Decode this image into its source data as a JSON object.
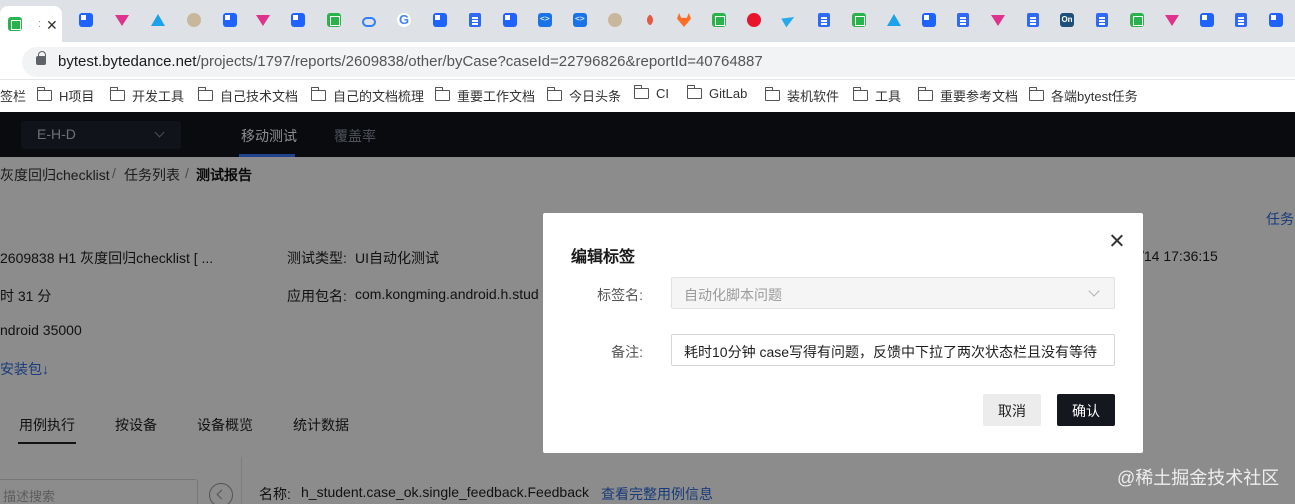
{
  "browser": {
    "active_tab_label": ":",
    "url_host": "bytest.bytedance.net",
    "url_path": "/projects/1797/reports/2609838/other/byCase?caseId=22796826&reportId=40764887"
  },
  "bookmarks": [
    {
      "label": "签栏",
      "folder": false
    },
    {
      "label": "H项目",
      "folder": true
    },
    {
      "label": "开发工具",
      "folder": true
    },
    {
      "label": "自己技术文档",
      "folder": true
    },
    {
      "label": "自己的文档梳理",
      "folder": true
    },
    {
      "label": "重要工作文档",
      "folder": true
    },
    {
      "label": "今日头条",
      "folder": true
    },
    {
      "label": "CI",
      "folder": true
    },
    {
      "label": "GitLab",
      "folder": true
    },
    {
      "label": "装机软件",
      "folder": true
    },
    {
      "label": "工具",
      "folder": true
    },
    {
      "label": "重要参考文档",
      "folder": true
    },
    {
      "label": "各端bytest任务",
      "folder": true
    }
  ],
  "header": {
    "project": "E-H-D",
    "tabs": [
      "移动测试",
      "覆盖率"
    ]
  },
  "breadcrumb": [
    "灰度回归checklist",
    "/",
    "任务列表",
    "/",
    "测试报告"
  ],
  "report": {
    "title": "2609838 H1 灰度回归checklist [ ...",
    "duration": "时 31 分",
    "device": "ndroid 35000",
    "install_link": "安装包",
    "download_icon": "↓",
    "test_type_label": "测试类型:",
    "test_type": "UI自动化测试",
    "package_label": "应用包名:",
    "package": "com.kongming.android.h.stud",
    "time": "/14 17:36:15",
    "right_link": "任务"
  },
  "sub_tabs": [
    "用例执行",
    "按设备",
    "设备概览",
    "统计数据"
  ],
  "search": {
    "placeholder": "描述搜索"
  },
  "case": {
    "name_label": "名称:",
    "name": "h_student.case_ok.single_feedback.Feedback",
    "detail_link": "查看完整用例信息"
  },
  "modal": {
    "title": "编辑标签",
    "tag_label": "标签名:",
    "tag_value": "自动化脚本问题",
    "note_label": "备注:",
    "note_value": "耗时10分钟 case写得有问题，反馈中下拉了两次状态栏且没有等待",
    "cancel": "取消",
    "confirm": "确认"
  },
  "watermark": "@稀土掘金技术社区"
}
